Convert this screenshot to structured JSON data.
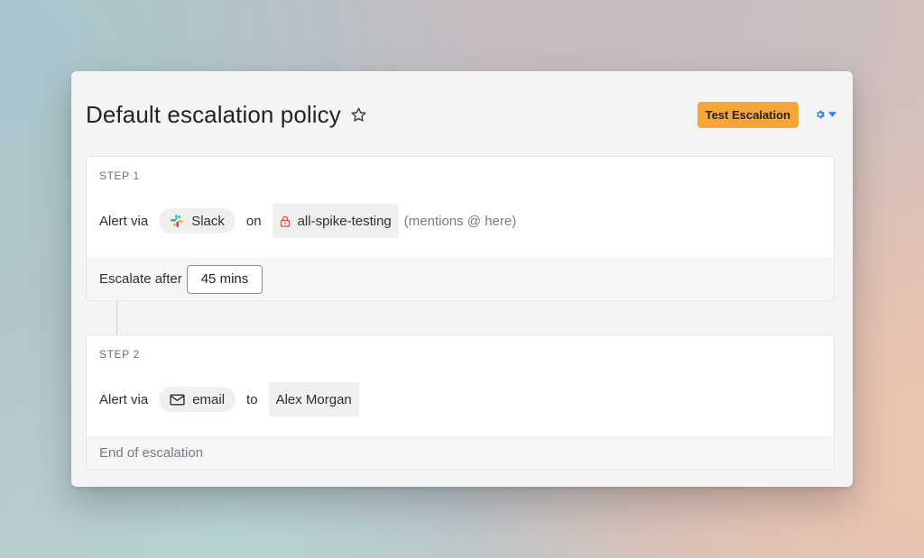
{
  "header": {
    "title": "Default escalation policy",
    "test_button_label": "Test Escalation"
  },
  "colors": {
    "accent_orange": "#f7a53a",
    "gear_blue": "#2f7fe0",
    "lock_red": "#e0483a"
  },
  "steps": [
    {
      "label": "STEP 1",
      "alert_via": "Alert via",
      "channel": {
        "icon": "slack-icon",
        "name": "Slack"
      },
      "connector_word": "on",
      "target": {
        "icon": "lock-icon",
        "name": "all-spike-testing"
      },
      "note": "(mentions @ here)",
      "footer": {
        "label": "Escalate after",
        "value": "45 mins"
      }
    },
    {
      "label": "STEP 2",
      "alert_via": "Alert via",
      "channel": {
        "icon": "email-icon",
        "name": "email"
      },
      "connector_word": "to",
      "target": {
        "name": "Alex Morgan"
      },
      "footer": {
        "label": "End of escalation"
      }
    }
  ]
}
